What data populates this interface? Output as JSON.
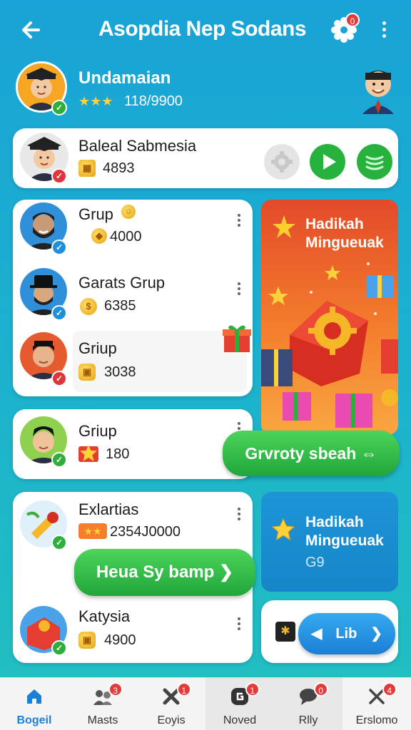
{
  "header": {
    "title": "Asopdia Nep Sodans",
    "notification_count": "0"
  },
  "profile": {
    "name": "Undamaian",
    "stars": "★★★",
    "score": "118/9900"
  },
  "featured": {
    "name": "Baleal Sabmesia",
    "value": "4893"
  },
  "groups": [
    {
      "name": "Grup",
      "value": "4000"
    },
    {
      "name": "Garats Grup",
      "value": "6385"
    },
    {
      "name": "Griup",
      "value": "3038"
    }
  ],
  "single_group": {
    "name": "Griup",
    "value": "180"
  },
  "promo_button_label": "Grvroty sbeah ⇔",
  "bottom_card": {
    "items": [
      {
        "name": "Exlartias",
        "value": "2354J0000"
      },
      {
        "name": "Katysia",
        "value": "4900"
      }
    ],
    "action_label": "Heua Sy bamp ❯"
  },
  "promo_red": {
    "title_line1": "Hadikah",
    "title_line2": "Mingueuak"
  },
  "promo_blue": {
    "title_line1": "Hadikah",
    "title_line2": "Mingueuak",
    "subtitle": "G9"
  },
  "lib_button_label": "Lib",
  "tabs": [
    {
      "label": "Bogeil",
      "icon": "home-icon",
      "badge": ""
    },
    {
      "label": "Masts",
      "icon": "users-icon",
      "badge": "3"
    },
    {
      "label": "Eoyis",
      "icon": "tools-icon",
      "badge": "1"
    },
    {
      "label": "Noved",
      "icon": "gamepad-icon",
      "badge": "1"
    },
    {
      "label": "Rlly",
      "icon": "chat-icon",
      "badge": "0"
    },
    {
      "label": "Erslomo",
      "icon": "close-icon",
      "badge": "4"
    }
  ],
  "colors": {
    "accent": "#1a7fd6",
    "green": "#20a63b",
    "badge": "#e23b3b",
    "promo_red": "#e34a2a"
  }
}
